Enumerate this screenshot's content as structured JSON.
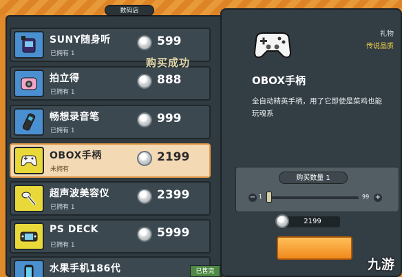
{
  "store": {
    "title": "数码店"
  },
  "items": [
    {
      "name": "SUNY随身听",
      "owned": "已拥有 1",
      "price": "599",
      "thumb": "walkman-icon"
    },
    {
      "name": "拍立得",
      "owned": "已拥有 1",
      "price": "888",
      "thumb": "instant-camera-icon"
    },
    {
      "name": "畅想录音笔",
      "owned": "已拥有 1",
      "price": "999",
      "thumb": "voice-recorder-icon"
    },
    {
      "name": "OBOX手柄",
      "owned": "未拥有",
      "price": "2199",
      "thumb": "gamepad-icon"
    },
    {
      "name": "超声波美容仪",
      "owned": "已拥有 1",
      "price": "2399",
      "thumb": "beauty-device-icon"
    },
    {
      "name": "PS DECK",
      "owned": "已拥有 1",
      "price": "5999",
      "thumb": "handheld-console-icon"
    },
    {
      "name": "水果手机186代",
      "owned": "",
      "price": "",
      "thumb": "phone-icon"
    }
  ],
  "toast": "购买成功",
  "sold_tag": "已售完",
  "detail": {
    "category": "礼物",
    "rarity": "传说品质",
    "title": "OBOX手柄",
    "description": "全自动精英手柄，用了它即使是菜鸡也能玩魂系",
    "qty_label": "购买数量 1",
    "qty_min": "1",
    "qty_max": "99",
    "qty_value": 1,
    "total": "2199"
  },
  "watermark": "九游",
  "colors": {
    "rarity": "#f2d548",
    "selected_row": "#f3d9b4",
    "buy_button": "#f08a1c"
  }
}
